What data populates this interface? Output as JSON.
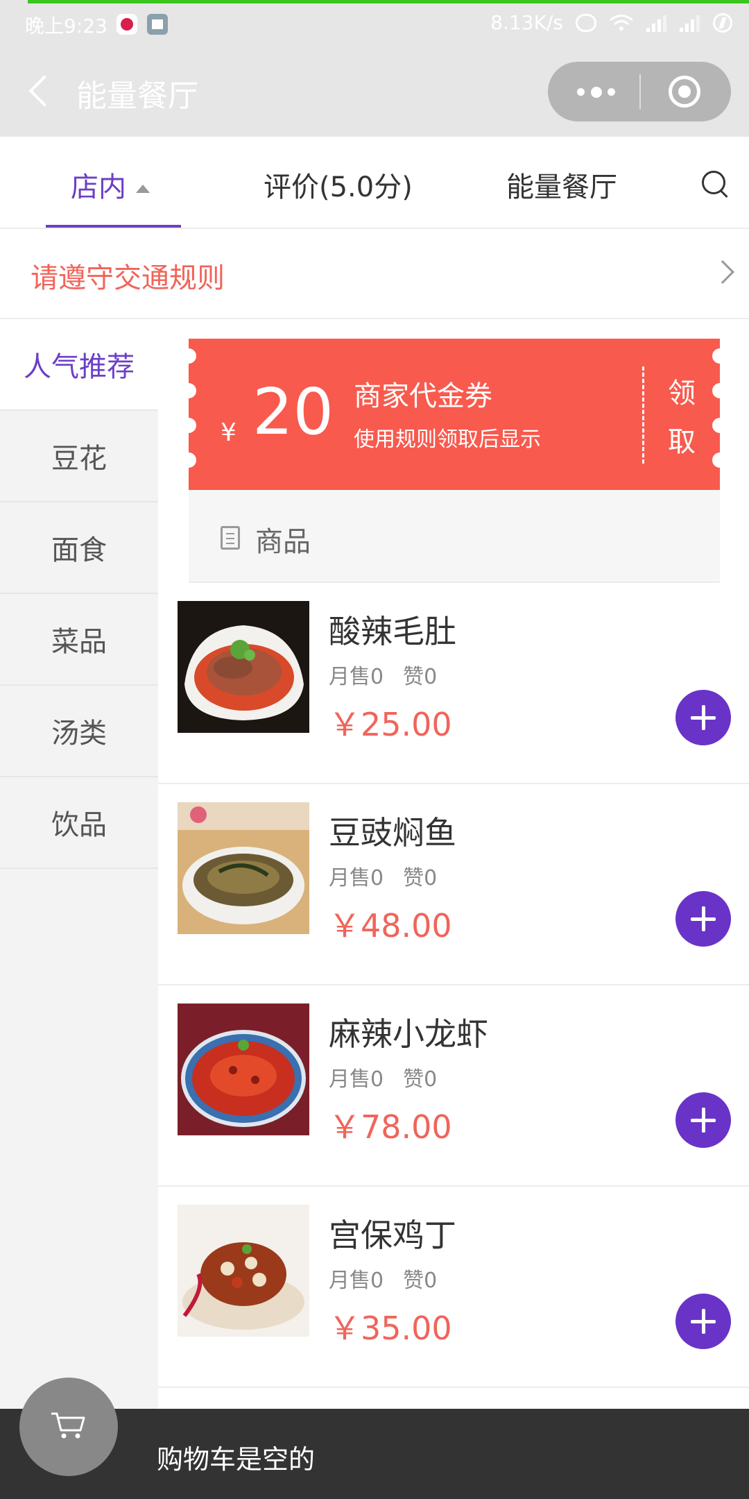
{
  "status_bar": {
    "time": "晚上9:23",
    "net_speed": "8.13K/s"
  },
  "nav": {
    "title": "能量餐厅"
  },
  "tabs": [
    {
      "label": "店内"
    },
    {
      "label": "评价(5.0分)"
    },
    {
      "label": "能量餐厅"
    }
  ],
  "notice": {
    "text": "请遵守交通规则"
  },
  "sidebar": {
    "items": [
      {
        "label": "人气推荐",
        "active": true
      },
      {
        "label": "豆花"
      },
      {
        "label": "面食"
      },
      {
        "label": "菜品"
      },
      {
        "label": "汤类"
      },
      {
        "label": "饮品"
      }
    ]
  },
  "coupon": {
    "currency": "¥",
    "amount": "20",
    "title": "商家代金券",
    "rule": "使用规则领取后显示",
    "claim_line1": "领",
    "claim_line2": "取"
  },
  "goods_section": {
    "label": "商品"
  },
  "dishes": [
    {
      "name": "酸辣毛肚",
      "monthly_sales": "月售0",
      "likes": "赞0",
      "price": "￥25.00"
    },
    {
      "name": "豆豉焖鱼",
      "monthly_sales": "月售0",
      "likes": "赞0",
      "price": "￥48.00"
    },
    {
      "name": "麻辣小龙虾",
      "monthly_sales": "月售0",
      "likes": "赞0",
      "price": "￥78.00"
    },
    {
      "name": "宫保鸡丁",
      "monthly_sales": "月售0",
      "likes": "赞0",
      "price": "￥35.00"
    }
  ],
  "cart": {
    "empty_text": "购物车是空的"
  },
  "colors": {
    "accent": "#6b3fc7",
    "price": "#f0645a",
    "coupon_bg": "#f85a4e",
    "add_button": "#6a33c8",
    "cart_bar": "#333333"
  }
}
